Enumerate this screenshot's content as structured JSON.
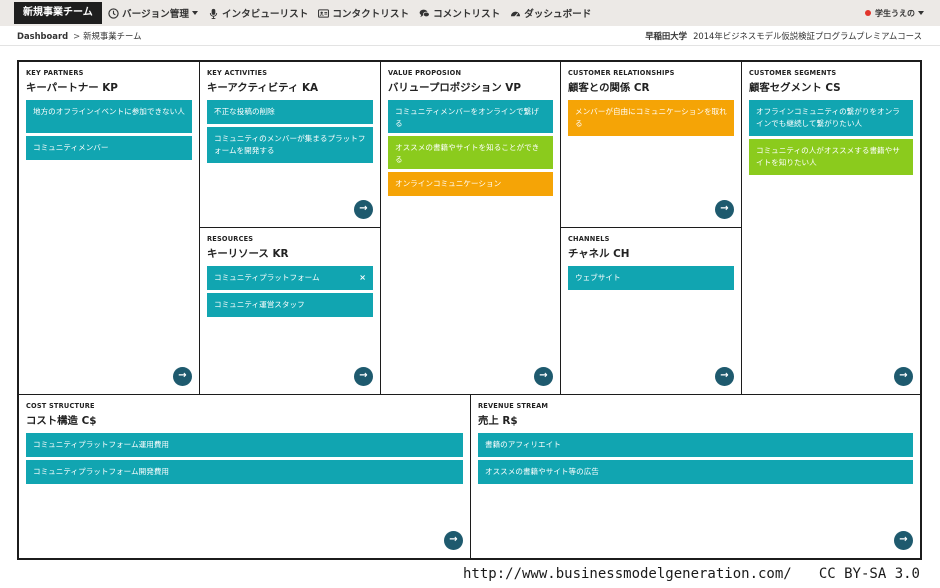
{
  "topbar": {
    "brand": "新規事業チーム",
    "nav": [
      {
        "icon": "clock-icon",
        "label": "バージョン管理",
        "dropdown": true
      },
      {
        "icon": "microphone-icon",
        "label": "インタビューリスト",
        "dropdown": false
      },
      {
        "icon": "address-card-icon",
        "label": "コンタクトリスト",
        "dropdown": false
      },
      {
        "icon": "comments-icon",
        "label": "コメントリスト",
        "dropdown": false
      },
      {
        "icon": "dashboard-icon",
        "label": "ダッシュボード",
        "dropdown": false
      }
    ],
    "user": "学生うえの"
  },
  "breadcrumb": {
    "home": "Dashboard",
    "separator": ">",
    "current": "新規事業チーム",
    "university": "早稲田大学",
    "course": "2014年ビジネスモデル仮説検証プログラムプレミアムコース"
  },
  "colors": {
    "teal": "#11a5b1",
    "green": "#8bcb1d",
    "orange": "#f5a406",
    "go_button": "#1e5a6e",
    "user_dot": "#e2342b"
  },
  "blocks": {
    "kp": {
      "en": "KEY PARTNERS",
      "jp": "キーパートナー KP",
      "notes": [
        {
          "text": "地方のオフラインイベントに参加できない人",
          "color": "teal"
        },
        {
          "text": "コミュニティメンバー",
          "color": "teal"
        }
      ]
    },
    "ka": {
      "en": "KEY ACTIVITIES",
      "jp": "キーアクティビティ KA",
      "notes": [
        {
          "text": "不正な投稿の削除",
          "color": "teal"
        },
        {
          "text": "コミュニティのメンバーが集まるプラットフォームを開発する",
          "color": "teal"
        }
      ]
    },
    "kr": {
      "en": "RESOURCES",
      "jp": "キーリソース KR",
      "notes": [
        {
          "text": "コミュニティプラットフォーム",
          "color": "teal",
          "close": "×"
        },
        {
          "text": "コミュニティ運営スタッフ",
          "color": "teal"
        }
      ]
    },
    "vp": {
      "en": "VALUE PROPOSION",
      "jp": "バリュープロポジション VP",
      "notes": [
        {
          "text": "コミュニティメンバーをオンラインで繋げる",
          "color": "teal"
        },
        {
          "text": "オススメの書籍やサイトを知ることができる",
          "color": "green"
        },
        {
          "text": "オンラインコミュニケーション",
          "color": "orange"
        }
      ]
    },
    "cr": {
      "en": "CUSTOMER RELATIONSHIPS",
      "jp": "顧客との関係 CR",
      "notes": [
        {
          "text": "メンバーが自由にコミュニケーションを取れる",
          "color": "orange"
        }
      ]
    },
    "ch": {
      "en": "CHANNELS",
      "jp": "チャネル CH",
      "notes": [
        {
          "text": "ウェブサイト",
          "color": "teal"
        }
      ]
    },
    "cs": {
      "en": "CUSTOMER SEGMENTS",
      "jp": "顧客セグメント CS",
      "notes": [
        {
          "text": "オフラインコミュニティの繋がりをオンラインでも継続して繋がりたい人",
          "color": "teal"
        },
        {
          "text": "コミュニティの人がオススメする書籍やサイトを知りたい人",
          "color": "green"
        }
      ]
    },
    "c$": {
      "en": "COST STRUCTURE",
      "jp": "コスト構造 C$",
      "notes": [
        {
          "text": "コミュニティプラットフォーム運用費用",
          "color": "teal"
        },
        {
          "text": "コミュニティプラットフォーム開発費用",
          "color": "teal"
        }
      ]
    },
    "r$": {
      "en": "REVENUE STREAM",
      "jp": "売上 R$",
      "notes": [
        {
          "text": "書籍のアフィリエイト",
          "color": "teal"
        },
        {
          "text": "オススメの書籍やサイト等の広告",
          "color": "teal"
        }
      ]
    }
  },
  "go_icon": "→",
  "credit": {
    "url": "http://www.businessmodelgeneration.com/",
    "license": "CC BY-SA 3.0"
  }
}
